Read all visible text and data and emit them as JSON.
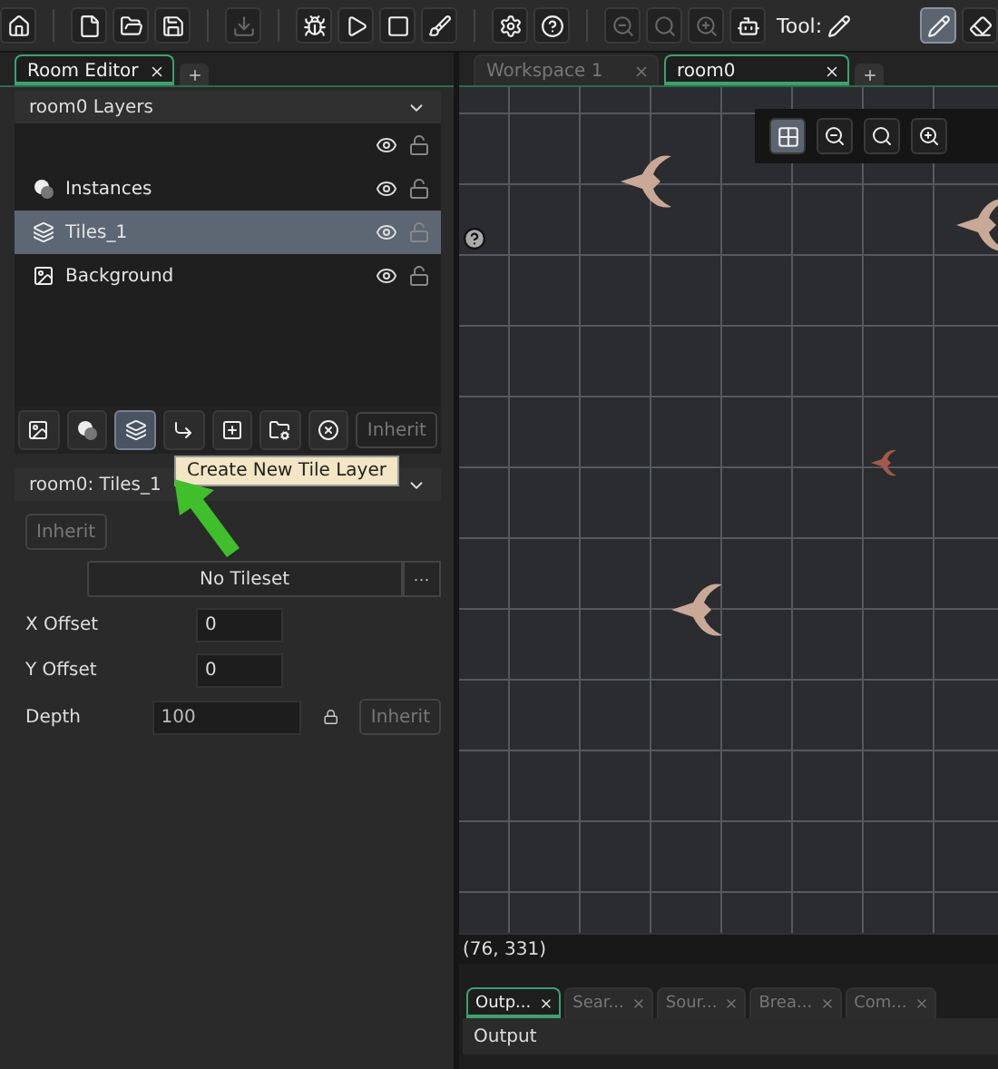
{
  "toolbar": {
    "groups": [
      [
        {
          "kind": "home",
          "disabled": false
        }
      ],
      [
        {
          "kind": "new",
          "disabled": false
        },
        {
          "kind": "open",
          "disabled": false
        },
        {
          "kind": "save",
          "disabled": false
        }
      ],
      [
        {
          "kind": "export",
          "disabled": true
        }
      ],
      [
        {
          "kind": "debug",
          "disabled": false
        },
        {
          "kind": "run",
          "disabled": false
        },
        {
          "kind": "stop",
          "disabled": false
        },
        {
          "kind": "clean",
          "disabled": false
        }
      ],
      [
        {
          "kind": "settings",
          "disabled": false
        },
        {
          "kind": "help",
          "disabled": false
        }
      ],
      [
        {
          "kind": "zoom-out",
          "disabled": true
        },
        {
          "kind": "zoom-reset",
          "disabled": true
        },
        {
          "kind": "zoom-in",
          "disabled": true
        },
        {
          "kind": "tool-picker",
          "disabled": false
        }
      ]
    ],
    "tool_label": "Tool:",
    "tools": [
      {
        "kind": "pencil",
        "selected": true
      },
      {
        "kind": "eraser",
        "selected": false
      }
    ]
  },
  "left_tabs": [
    {
      "label": "Room Editor",
      "selected": true
    }
  ],
  "layers_panel": {
    "title": "room0 Layers",
    "layers": [
      {
        "kind": "instances",
        "name": "Instances",
        "selected": false
      },
      {
        "kind": "tiles",
        "name": "Tiles_1",
        "selected": true
      },
      {
        "kind": "background",
        "name": "Background",
        "selected": false
      }
    ],
    "buttons": [
      {
        "kind": "background",
        "selected": false
      },
      {
        "kind": "instances",
        "selected": false
      },
      {
        "kind": "tiles",
        "selected": true
      },
      {
        "kind": "path",
        "selected": false
      },
      {
        "kind": "asset",
        "selected": false
      },
      {
        "kind": "folder",
        "selected": false
      },
      {
        "kind": "delete",
        "selected": false
      }
    ],
    "inherit": "Inherit"
  },
  "tooltip": "Create New Tile Layer",
  "properties": {
    "title": "room0: Tiles_1",
    "inherit": "Inherit",
    "tileset": "No Tileset",
    "tileset_more": "···",
    "fields": [
      {
        "kind": "plain",
        "label": "X Offset",
        "value": "0"
      },
      {
        "kind": "plain",
        "label": "Y Offset",
        "value": "0"
      },
      {
        "kind": "locked",
        "label": "Depth",
        "value": "100",
        "inherit": "Inherit"
      }
    ]
  },
  "right_tabs": [
    {
      "label": "Workspace 1",
      "selected": false
    },
    {
      "label": "room0",
      "selected": true
    }
  ],
  "coordinates": "(76, 331)",
  "output_tabs": [
    {
      "label": "Outp...",
      "selected": true
    },
    {
      "label": "Sear...",
      "selected": false
    },
    {
      "label": "Sour...",
      "selected": false
    },
    {
      "label": "Brea...",
      "selected": false
    },
    {
      "label": "Com...",
      "selected": false
    }
  ],
  "output_title": "Output"
}
